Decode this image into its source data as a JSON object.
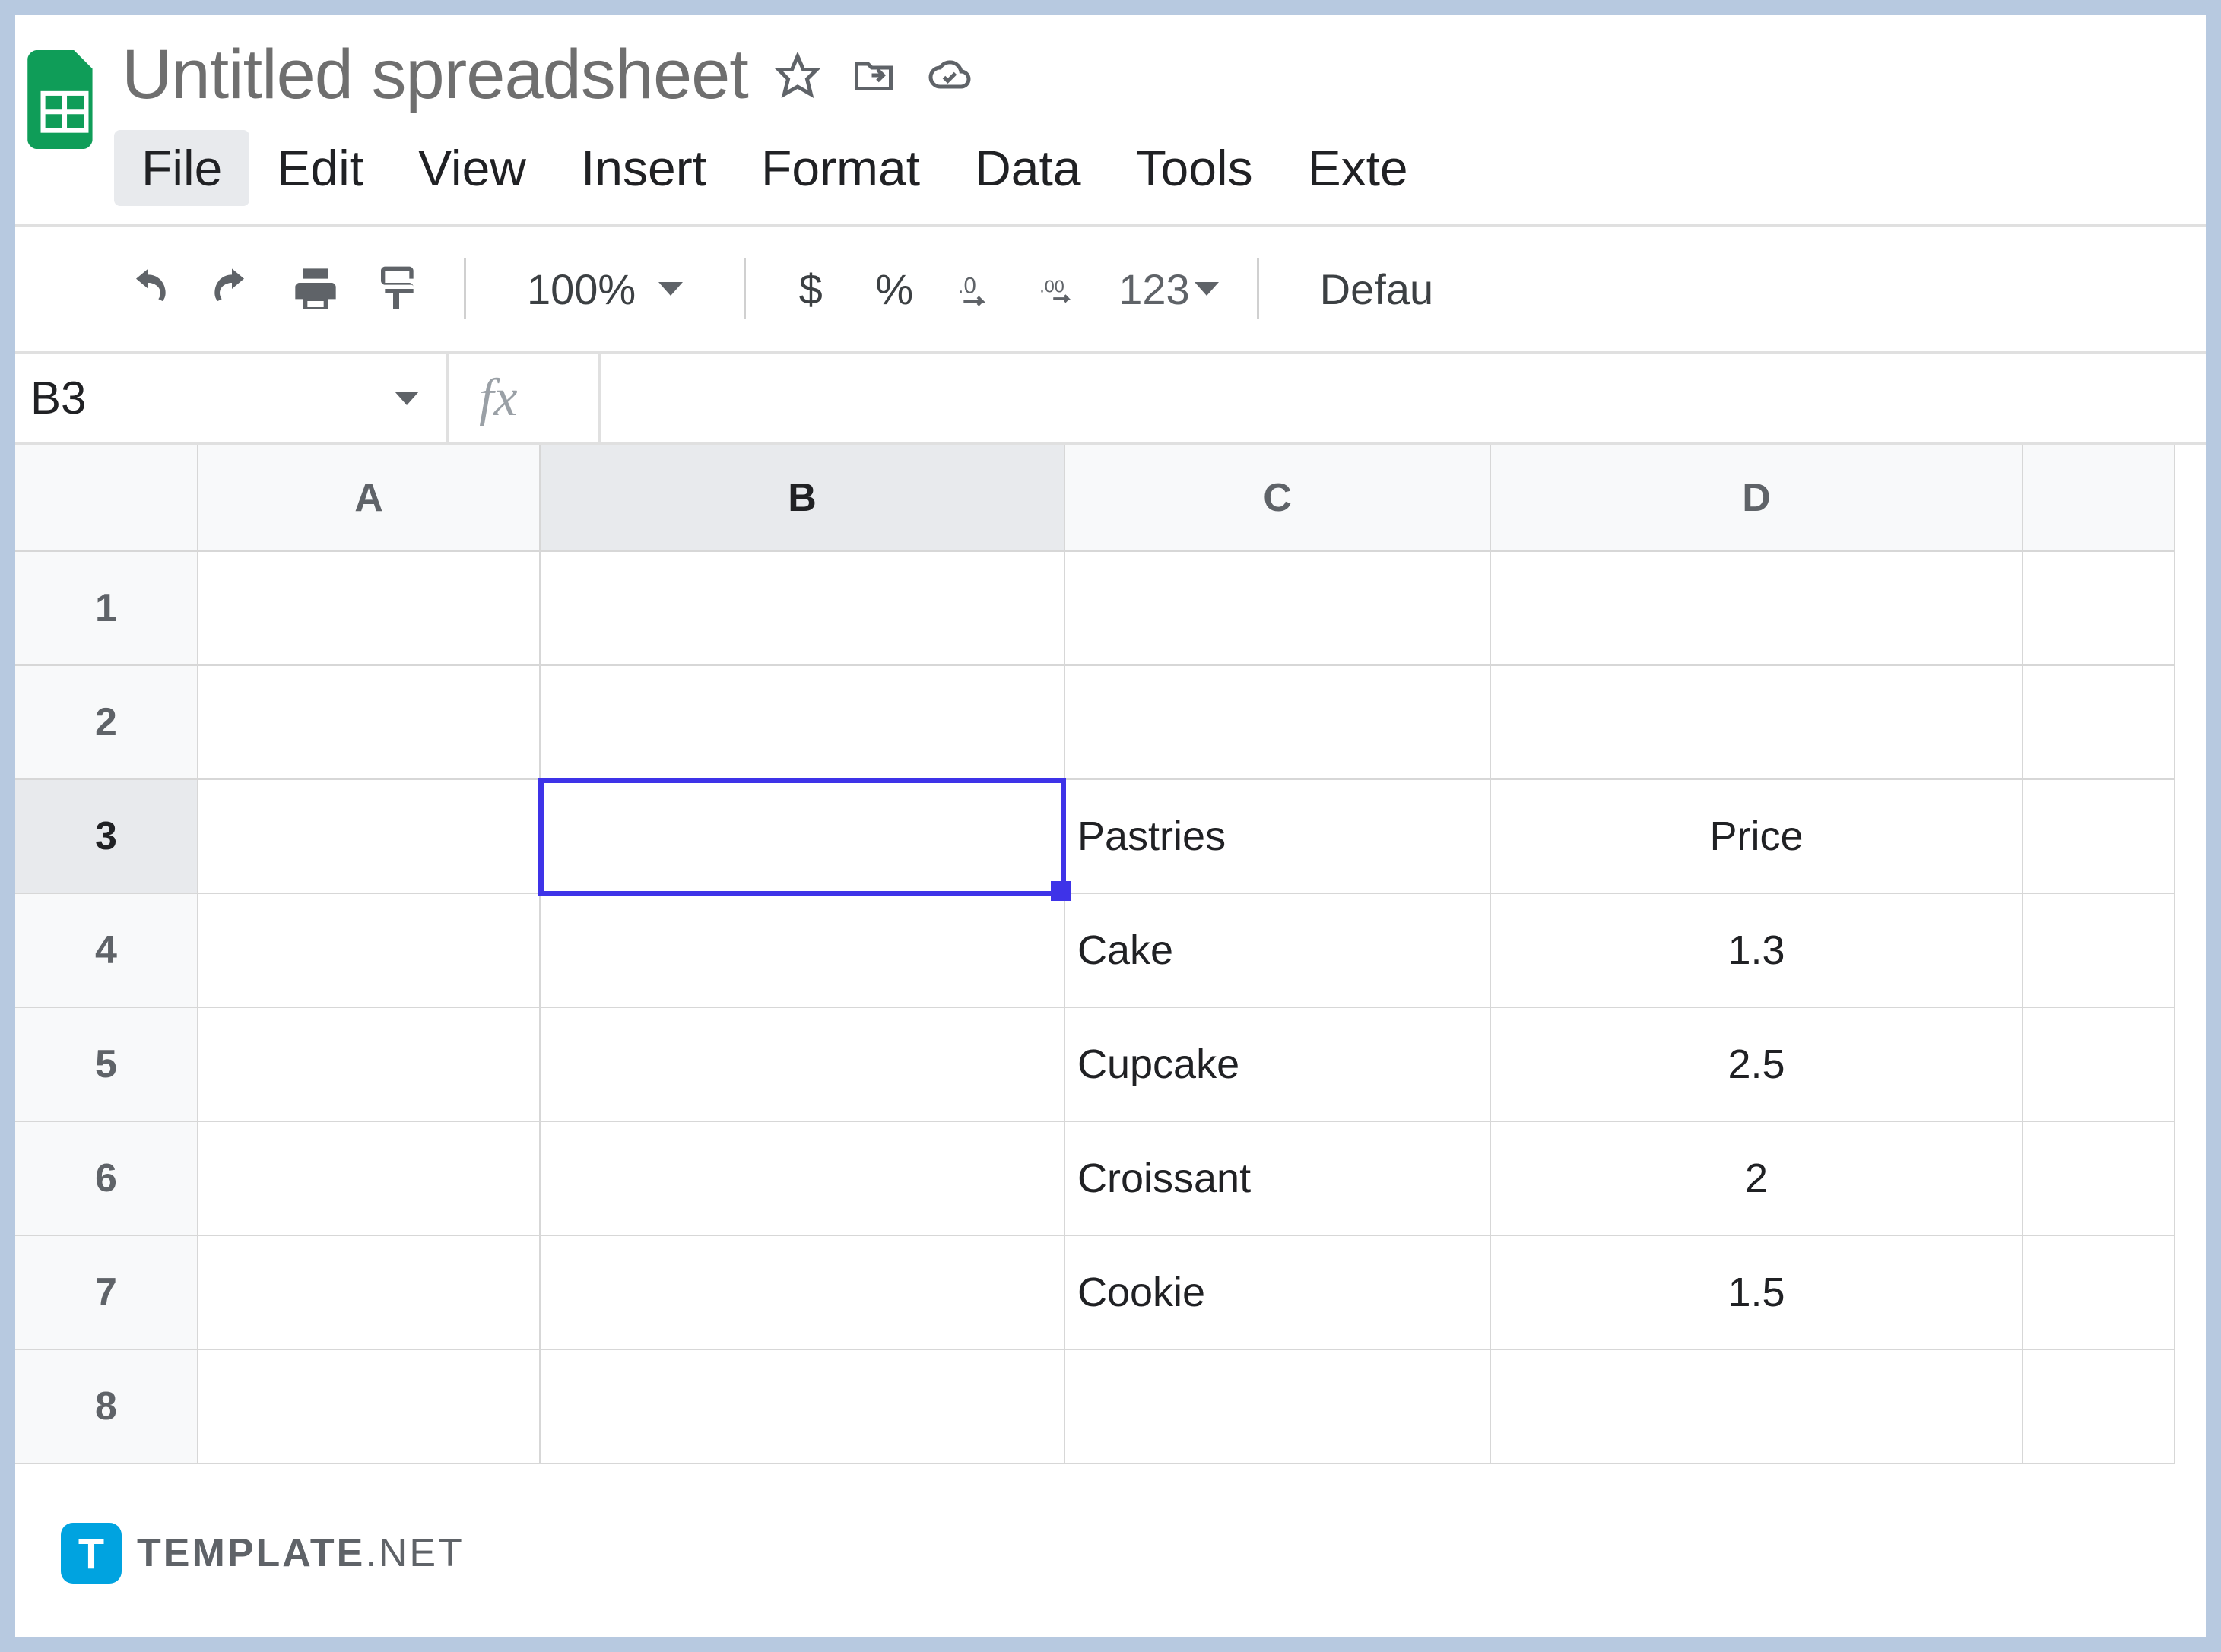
{
  "doc": {
    "title": "Untitled spreadsheet"
  },
  "menu": {
    "file": "File",
    "edit": "Edit",
    "view": "View",
    "insert": "Insert",
    "format": "Format",
    "data": "Data",
    "tools": "Tools",
    "extensions": "Exte"
  },
  "toolbar": {
    "zoom": "100%",
    "currency": "$",
    "percent": "%",
    "dec_decrease": ".0",
    "dec_increase": ".00",
    "more_formats": "123",
    "font_partial": "Defau"
  },
  "name_box": {
    "value": "B3"
  },
  "fx": {
    "label": "fx",
    "value": ""
  },
  "columns": {
    "A": "A",
    "B": "B",
    "C": "C",
    "D": "D"
  },
  "rows": {
    "1": "1",
    "2": "2",
    "3": "3",
    "4": "4",
    "5": "5",
    "6": "6",
    "7": "7",
    "8": "8"
  },
  "cells": {
    "C3": "Pastries",
    "D3": "Price",
    "C4": "Cake",
    "D4": "1.3",
    "C5": "Cupcake",
    "D5": "2.5",
    "C6": "Croissant",
    "D6": "2",
    "C7": "Cookie",
    "D7": "1.5"
  },
  "watermark": {
    "icon": "T",
    "brand": "TEMPLATE",
    "suffix": ".NET"
  }
}
